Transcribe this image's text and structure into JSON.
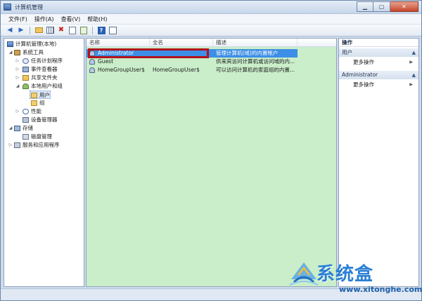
{
  "window": {
    "title": "计算机管理"
  },
  "menu": [
    "文件(F)",
    "操作(A)",
    "查看(V)",
    "帮助(H)"
  ],
  "tree": [
    {
      "label": "计算机管理(本地)",
      "icon": "computer-icon",
      "level": 0,
      "toggle": ""
    },
    {
      "label": "系统工具",
      "icon": "tools-icon",
      "level": 1,
      "toggle": "◢"
    },
    {
      "label": "任务计划程序",
      "icon": "clock-icon",
      "level": 2,
      "toggle": "▷"
    },
    {
      "label": "事件查看器",
      "icon": "event-viewer-icon",
      "level": 2,
      "toggle": "▷"
    },
    {
      "label": "共享文件夹",
      "icon": "shared-folder-icon",
      "level": 2,
      "toggle": "▷"
    },
    {
      "label": "本地用户和组",
      "icon": "users-icon",
      "level": 2,
      "toggle": "◢"
    },
    {
      "label": "用户",
      "icon": "folder-icon",
      "level": 3,
      "toggle": "",
      "selected": true
    },
    {
      "label": "组",
      "icon": "folder-icon",
      "level": 3,
      "toggle": ""
    },
    {
      "label": "性能",
      "icon": "performance-icon",
      "level": 2,
      "toggle": "▷"
    },
    {
      "label": "设备管理器",
      "icon": "device-manager-icon",
      "level": 2,
      "toggle": ""
    },
    {
      "label": "存储",
      "icon": "storage-icon",
      "level": 1,
      "toggle": "◢"
    },
    {
      "label": "磁盘管理",
      "icon": "disk-icon",
      "level": 2,
      "toggle": ""
    },
    {
      "label": "服务和应用程序",
      "icon": "services-icon",
      "level": 1,
      "toggle": "▷"
    }
  ],
  "list": {
    "columns": [
      "名称",
      "全名",
      "描述"
    ],
    "rows": [
      {
        "name": "Administrator",
        "fullname": "",
        "description": "管理计算机(域)的内置帐户",
        "selected": true
      },
      {
        "name": "Guest",
        "fullname": "",
        "description": "供来宾访问计算机或访问域的内...",
        "selected": false
      },
      {
        "name": "HomeGroupUser$",
        "fullname": "HomeGroupUser$",
        "description": "可以访问计算机的家庭组的内置...",
        "selected": false
      }
    ]
  },
  "actions": {
    "title": "操作",
    "sections": [
      {
        "header": "用户",
        "items": [
          "更多操作"
        ]
      },
      {
        "header": "Administrator",
        "items": [
          "更多操作"
        ]
      }
    ]
  },
  "watermark": {
    "brand": "系统盒",
    "url": "www.xitonghe.com"
  },
  "colors": {
    "list_bg": "#c9eec9",
    "selection": "#3d8ee6",
    "highlight_border": "#b3121a"
  }
}
